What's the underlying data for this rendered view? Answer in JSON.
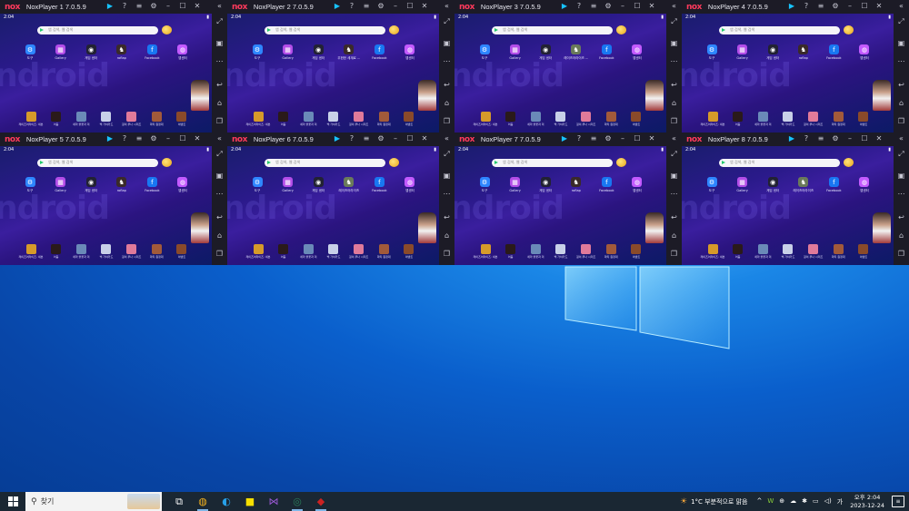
{
  "windows": [
    {
      "title": "NoxPlayer 1 7.0.5.9",
      "app4_label": "roflap",
      "app4_color": "#3a2a2a"
    },
    {
      "title": "NoxPlayer 2 7.0.5.9",
      "app4_label": "무한한 세계로 ...",
      "app4_color": "#3a2a2a"
    },
    {
      "title": "NoxPlayer 3 7.0.5.9",
      "app4_label": "레이즈어라이즈 ...",
      "app4_color": "#6a7a5a"
    },
    {
      "title": "NoxPlayer 4 7.0.5.9",
      "app4_label": "roflap",
      "app4_color": "#3a2a2a"
    },
    {
      "title": "NoxPlayer 5 7.0.5.9",
      "app4_label": "roflap",
      "app4_color": "#3a2a2a"
    },
    {
      "title": "NoxPlayer 6 7.0.5.9",
      "app4_label": "레이즈어라이즈",
      "app4_color": "#6a7a5a"
    },
    {
      "title": "NoxPlayer 7 7.0.5.9",
      "app4_label": "roflap",
      "app4_color": "#3a2a2a"
    },
    {
      "title": "NoxPlayer 8 7.0.5.9",
      "app4_label": "레이즈어라이즈",
      "app4_color": "#6a7a5a"
    }
  ],
  "nox_logo": "nox",
  "android": {
    "clock": "2:04",
    "battery": "▮",
    "search_placeholder": "앱 검색, 웹 검색",
    "watermark": "ndroid",
    "apps": [
      {
        "label": "도구",
        "icon": "tools-icon",
        "color": "#2e86ff",
        "glyph": "⚙"
      },
      {
        "label": "Gallery",
        "icon": "gallery-icon",
        "color": "#b34de8",
        "glyph": "▦"
      },
      {
        "label": "게임 센터",
        "icon": "gamepad-icon",
        "color": "#222233",
        "glyph": "◉"
      },
      {
        "label": "",
        "icon": "game-icon",
        "color": "#3a2a2a",
        "glyph": "♞"
      },
      {
        "label": "Facebook",
        "icon": "facebook-icon",
        "color": "#1877f2",
        "glyph": "f"
      },
      {
        "label": "앱센터",
        "icon": "app-center-icon",
        "color": "#c35aff",
        "glyph": "◍"
      }
    ],
    "dock": [
      {
        "label": "레이즈어라이즈: 세븐",
        "color": "#d69a2a"
      },
      {
        "label": "어둠",
        "color": "#2a1a1a"
      },
      {
        "label": "세라 불꽃과 미",
        "color": "#6a8ab8"
      },
      {
        "label": "백 가챠카드",
        "color": "#c8d0e8"
      },
      {
        "label": "걸이 루나 시리즈",
        "color": "#e07a9a"
      },
      {
        "label": "파티 원정대",
        "color": "#a25a3a"
      },
      {
        "label": "이벤트",
        "color": "#8a4a2a"
      }
    ]
  },
  "taskbar": {
    "search_label": "찾기",
    "apps": [
      {
        "name": "task-view-icon",
        "glyph": "⧉",
        "color": "#ffffff",
        "active": false
      },
      {
        "name": "chrome-icon",
        "glyph": "◍",
        "color": "#f2b01e",
        "active": true
      },
      {
        "name": "edge-icon",
        "glyph": "◐",
        "color": "#27a0e8",
        "active": false
      },
      {
        "name": "kakaotalk-icon",
        "glyph": "■",
        "color": "#f9e000",
        "active": false
      },
      {
        "name": "visual-studio-icon",
        "glyph": "⋈",
        "color": "#9b59d6",
        "active": false
      },
      {
        "name": "nox-multi-icon",
        "glyph": "◎",
        "color": "#2a7f5a",
        "active": true
      },
      {
        "name": "game-app-icon",
        "glyph": "◆",
        "color": "#cc2222",
        "active": true
      }
    ],
    "weather": "1°C  부분적으로 맑음",
    "time": "오후 2:04",
    "date": "2023-12-24"
  }
}
